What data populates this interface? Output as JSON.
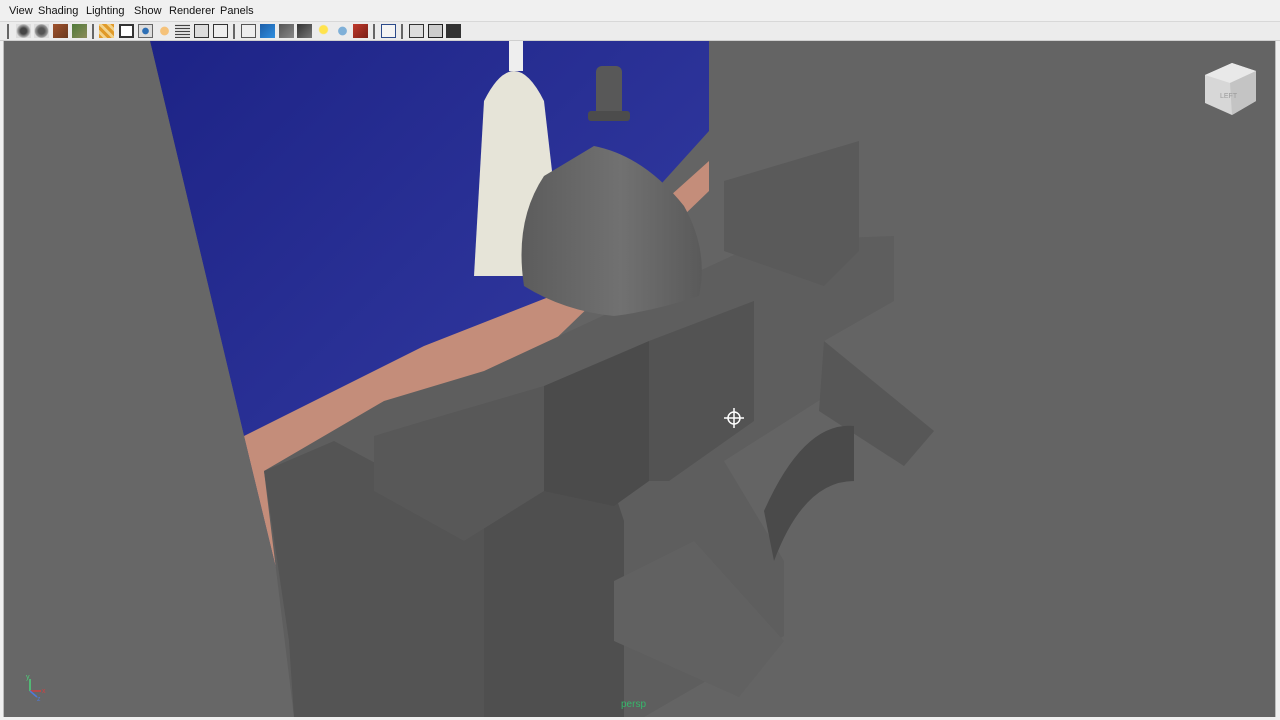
{
  "menu": [
    "View",
    "Shading",
    "Lighting",
    "Show",
    "Renderer",
    "Panels"
  ],
  "toolbar": {
    "icons": [
      "select-camera-icon",
      "lock-camera-icon",
      "bookmark-icon",
      "image-plane-icon",
      "grease-pencil-icon",
      "film-gate-icon",
      "resolution-gate-icon",
      "field-chart-icon",
      "safe-action-icon",
      "safe-title-icon",
      "grid-icon",
      "wireframe-icon",
      "smooth-shade-icon",
      "shaded-wireframe-icon",
      "textured-icon",
      "use-lights-icon",
      "shadows-icon",
      "ambient-occlusion-icon",
      "xray-icon",
      "isolate-select-icon",
      "two-sided-icon",
      "hud-icon",
      "motion-trail-icon"
    ]
  },
  "viewport": {
    "camera_label": "persp",
    "viewcube_face": "LEFT",
    "axis": {
      "x": "x",
      "y": "y",
      "z": "z"
    },
    "background_color": "#646464",
    "backdrop_colors": {
      "sky": "#23288f",
      "building": "#c48d7a"
    }
  }
}
